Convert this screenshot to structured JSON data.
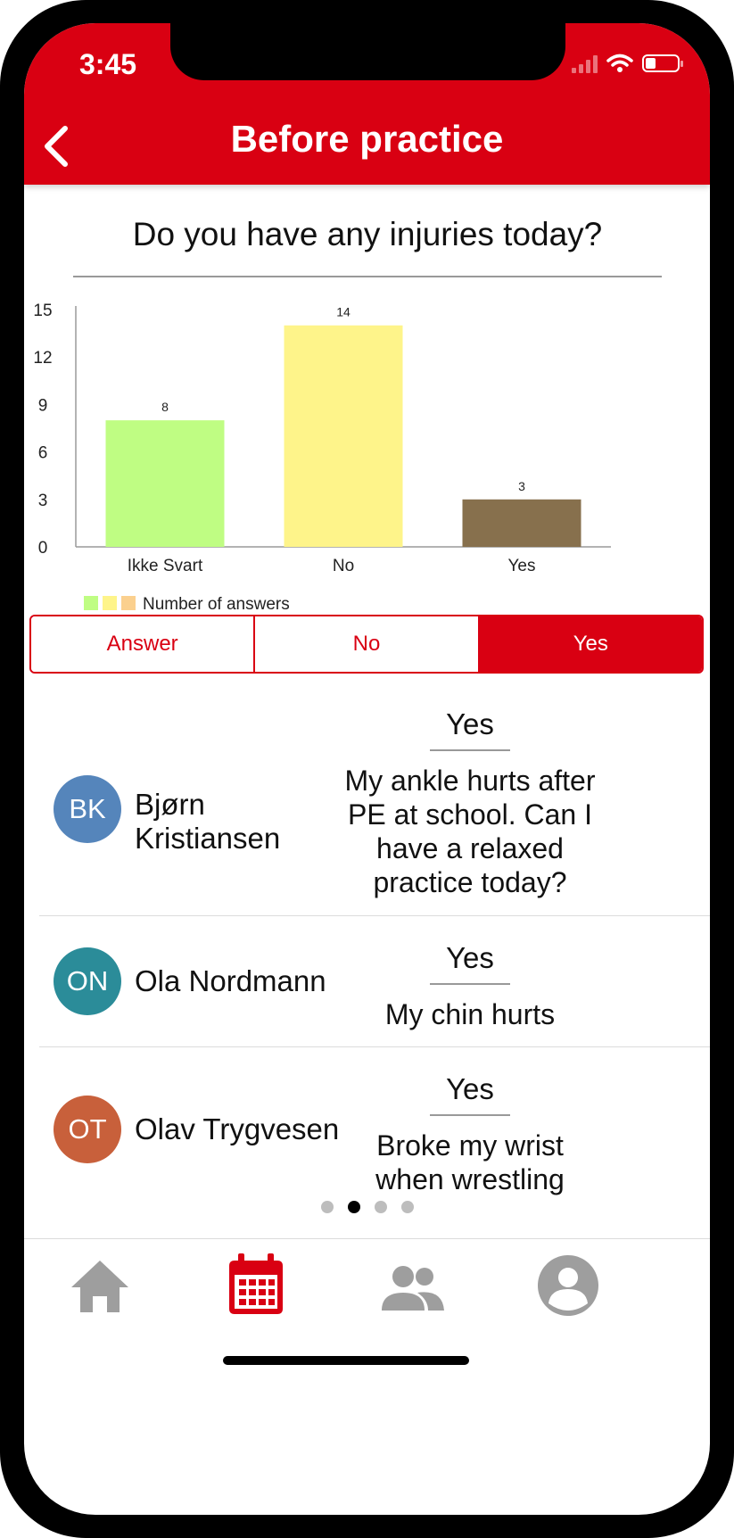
{
  "status_bar": {
    "time": "3:45"
  },
  "header": {
    "title": "Before practice"
  },
  "question": "Do you have any injuries today?",
  "chart_data": {
    "type": "bar",
    "categories": [
      "Ikke Svart",
      "No",
      "Yes"
    ],
    "values": [
      8,
      14,
      3
    ],
    "colors": [
      "#bffd83",
      "#fef48a",
      "#87704d"
    ],
    "yticks": [
      0,
      3,
      6,
      9,
      12,
      15
    ],
    "ylim": [
      0,
      15
    ],
    "legend": {
      "label": "Number of answers",
      "swatches": [
        "#bffd83",
        "#fef48a",
        "#fbd08e"
      ],
      "position": "bottom-left"
    }
  },
  "filter": {
    "options": [
      "Answer",
      "No",
      "Yes"
    ],
    "selected": "Yes"
  },
  "responses": [
    {
      "initials": "BK",
      "name_lines": [
        "Bjørn",
        "Kristiansen"
      ],
      "avatar_color": "#5585bb",
      "answer": "Yes",
      "comment_lines": [
        "My ankle hurts after",
        "PE at school. Can I",
        "have a relaxed",
        "practice today?"
      ]
    },
    {
      "initials": "ON",
      "name_lines": [
        "Ola Nordmann"
      ],
      "avatar_color": "#2b8c99",
      "answer": "Yes",
      "comment_lines": [
        "My chin hurts"
      ]
    },
    {
      "initials": "OT",
      "name_lines": [
        "Olav Trygvesen"
      ],
      "avatar_color": "#c8603b",
      "answer": "Yes",
      "comment_lines": [
        "Broke my wrist",
        "when wrestling"
      ]
    }
  ],
  "pager": {
    "count": 4,
    "active": 1
  },
  "tabbar": {
    "items": [
      {
        "icon": "home-icon",
        "active": false
      },
      {
        "icon": "calendar-icon",
        "active": true
      },
      {
        "icon": "people-icon",
        "active": false
      },
      {
        "icon": "profile-icon",
        "active": false
      }
    ],
    "active_color": "#d90012",
    "inactive_color": "#9e9e9e"
  },
  "theme": {
    "primary": "#d90012"
  }
}
